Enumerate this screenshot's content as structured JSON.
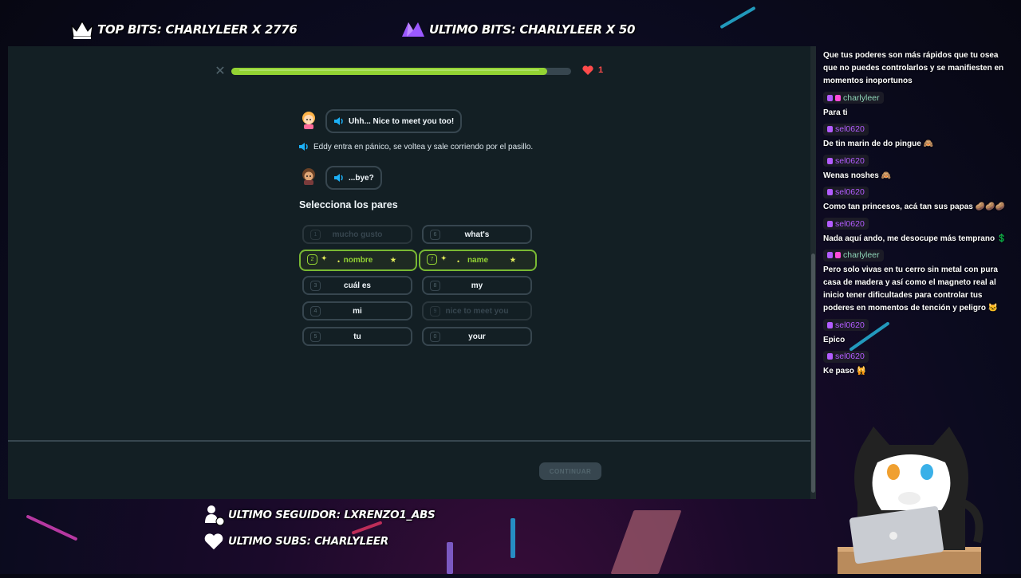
{
  "overlay": {
    "top_bits": "TOP BITS: CHARLYLEER X 2776",
    "ultimo_bits": "ULTIMO BITS: CHARLYLEER X 50",
    "ultimo_seguidor": "ULTIMO SEGUIDOR: LXRENZO1_ABS",
    "ultimo_subs": "ULTIMO SUBS: CHARLYLEER"
  },
  "lesson": {
    "progress_fraction": 0.93,
    "hearts": "1",
    "bubble1": "Uhh... Nice to meet you too!",
    "narration": "Eddy entra en pánico, se voltea y sale corriendo por el pasillo.",
    "bubble2": "...bye?",
    "prompt": "Selecciona los pares",
    "left_tiles": [
      {
        "num": "1",
        "text": "mucho gusto",
        "state": "disabled"
      },
      {
        "num": "2",
        "text": "nombre",
        "state": "selected"
      },
      {
        "num": "3",
        "text": "cuál es",
        "state": "normal"
      },
      {
        "num": "4",
        "text": "mi",
        "state": "normal"
      },
      {
        "num": "5",
        "text": "tu",
        "state": "normal"
      }
    ],
    "right_tiles": [
      {
        "num": "6",
        "text": "what's",
        "state": "normal"
      },
      {
        "num": "7",
        "text": "name",
        "state": "selected"
      },
      {
        "num": "8",
        "text": "my",
        "state": "normal"
      },
      {
        "num": "9",
        "text": "nice to meet you",
        "state": "disabled"
      },
      {
        "num": "0",
        "text": "your",
        "state": "normal"
      }
    ],
    "continue_label": "CONTINUAR"
  },
  "chat": [
    {
      "user": "",
      "user_color": "",
      "text": "Que tus poderes son más rápidos que tu osea que no puedes controlarlos y se manifiesten en momentos inoportunos"
    },
    {
      "user": "charlyleer",
      "user_color": "#8fd6b8",
      "text": "Para ti"
    },
    {
      "user": "sel0620",
      "user_color": "#b35cff",
      "text": "De tin marin de do pingue 🙈"
    },
    {
      "user": "sel0620",
      "user_color": "#b35cff",
      "text": "Wenas noshes 🙈"
    },
    {
      "user": "sel0620",
      "user_color": "#b35cff",
      "text": "Como tan princesos, acá tan sus papas 🥔🥔🥔"
    },
    {
      "user": "sel0620",
      "user_color": "#b35cff",
      "text": "Nada aquí ando, me desocupe más temprano 💲"
    },
    {
      "user": "charlyleer",
      "user_color": "#8fd6b8",
      "text": "Pero solo vivas en tu cerro sin metal con pura casa de madera y así como el magneto real al inicio tener dificultades para controlar tus poderes en momentos de tención y peligro 🐱"
    },
    {
      "user": "sel0620",
      "user_color": "#b35cff",
      "text": "Epico"
    },
    {
      "user": "sel0620",
      "user_color": "#b35cff",
      "text": "Ke paso 🙀"
    }
  ]
}
